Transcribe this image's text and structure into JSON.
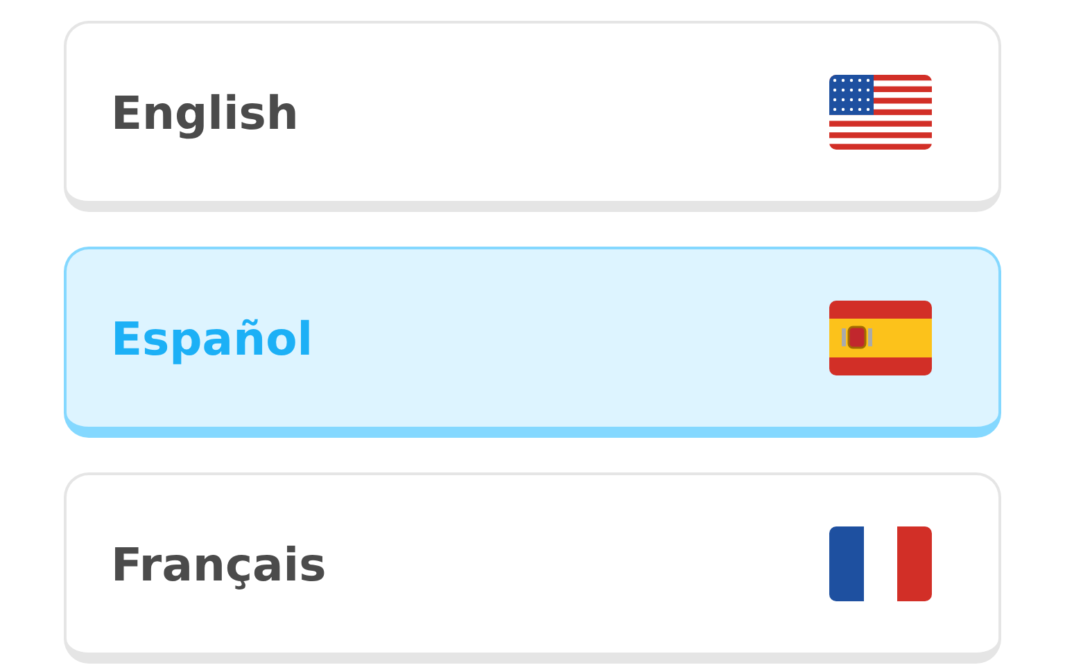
{
  "languages": [
    {
      "label": "English",
      "selected": false
    },
    {
      "label": "Español",
      "selected": true
    },
    {
      "label": "Français",
      "selected": false
    }
  ]
}
